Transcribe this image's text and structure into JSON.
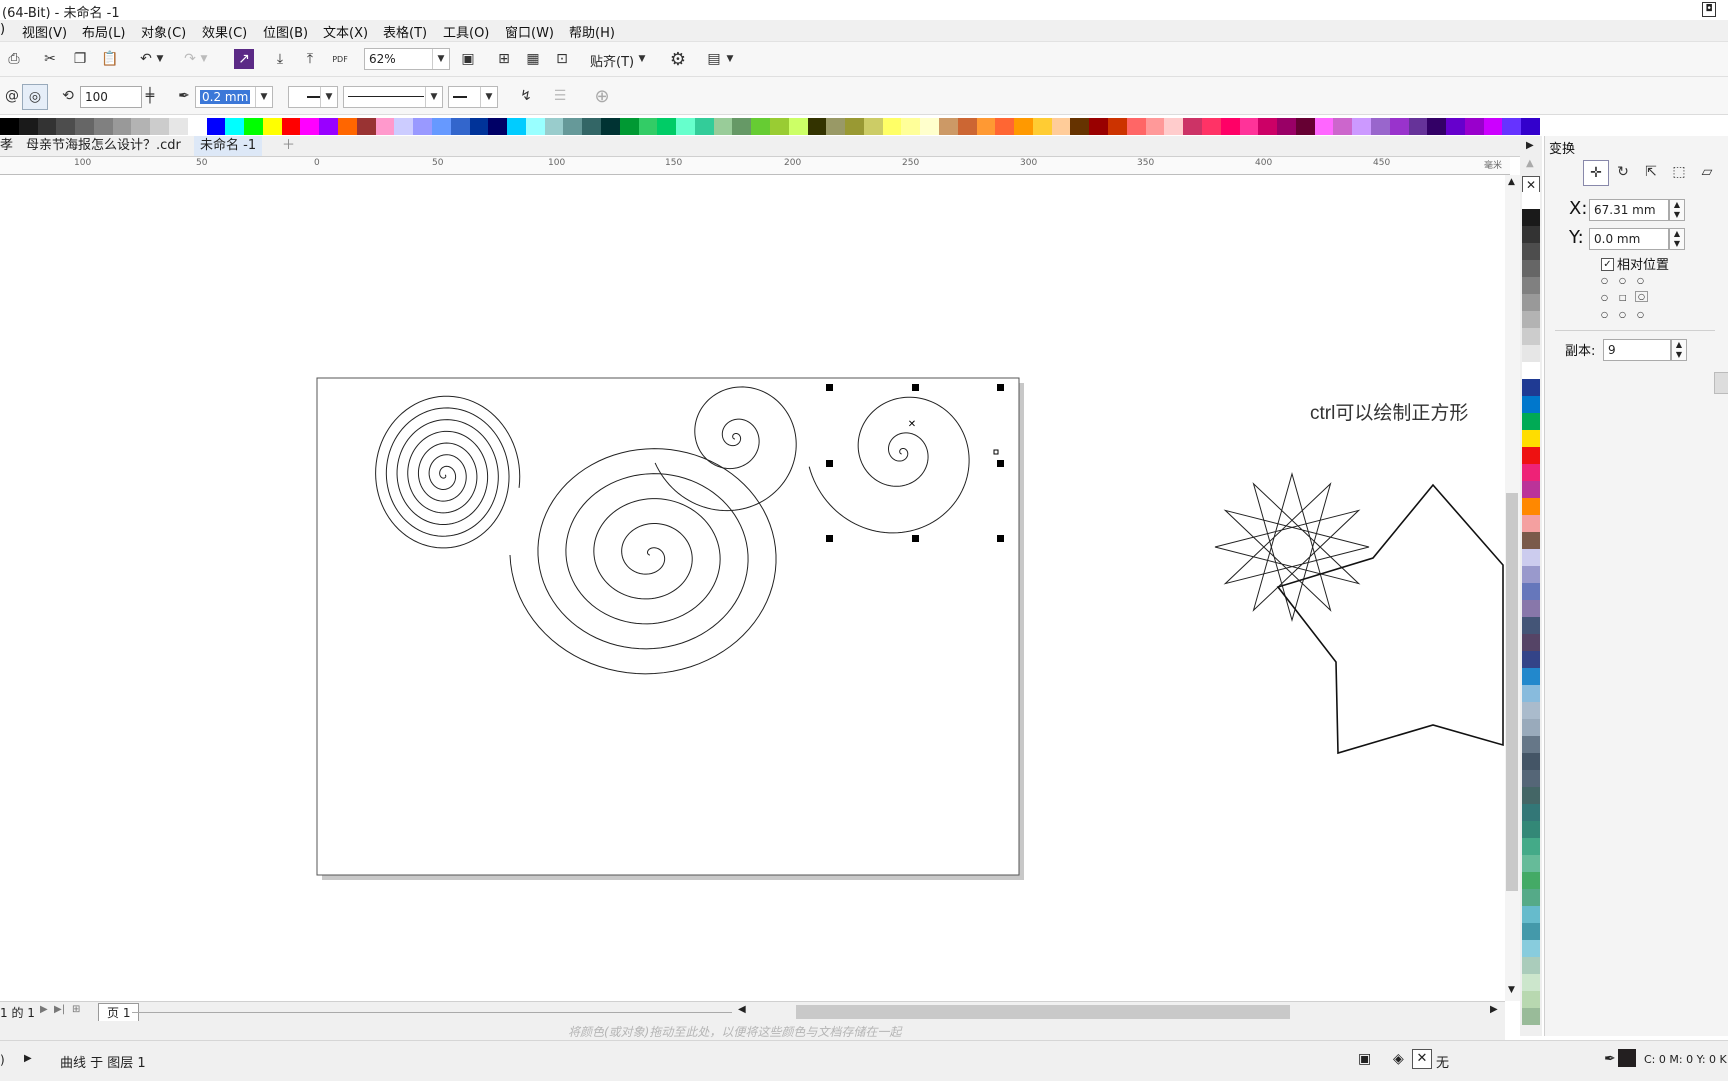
{
  "window": {
    "title": "(64-Bit) - 未命名 -1"
  },
  "menu": [
    "视图(V)",
    "布局(L)",
    "对象(C)",
    "效果(C)",
    "位图(B)",
    "文本(X)",
    "表格(T)",
    "工具(O)",
    "窗口(W)",
    "帮助(H)"
  ],
  "menu_partial": ")",
  "toolbar": {
    "zoom_value": "62%",
    "snap_label": "贴齐(T)",
    "pdf_label": "PDF"
  },
  "property_bar": {
    "revolutions_value": "100",
    "outline_width": "0.2 mm"
  },
  "palette_colors": [
    "#000000",
    "#1a1a1a",
    "#333333",
    "#4d4d4d",
    "#666666",
    "#808080",
    "#999999",
    "#b3b3b3",
    "#cccccc",
    "#e6e6e6",
    "#ffffff",
    "#0000ff",
    "#00ffff",
    "#00ff00",
    "#ffff00",
    "#ff0000",
    "#ff00ff",
    "#9900ff",
    "#ff6600",
    "#993333",
    "#ff99cc",
    "#ccccff",
    "#9999ff",
    "#6699ff",
    "#3366cc",
    "#003399",
    "#000066",
    "#00ccff",
    "#99ffff",
    "#99cccc",
    "#669999",
    "#336666",
    "#003333",
    "#009933",
    "#33cc66",
    "#00cc66",
    "#66ffcc",
    "#33cc99",
    "#99cc99",
    "#669966",
    "#66cc33",
    "#99cc33",
    "#ccff66",
    "#333300",
    "#999966",
    "#999933",
    "#cccc66",
    "#ffff66",
    "#ffff99",
    "#ffffcc",
    "#cc9966",
    "#cc6633",
    "#ff9933",
    "#ff6633",
    "#ff9900",
    "#ffcc33",
    "#ffcc99",
    "#663300",
    "#990000",
    "#cc3300",
    "#ff6666",
    "#ff9999",
    "#ffcccc",
    "#cc3366",
    "#ff3366",
    "#ff0066",
    "#ff3399",
    "#cc0066",
    "#990066",
    "#660033",
    "#ff66ff",
    "#cc66cc",
    "#cc99ff",
    "#9966cc",
    "#9933cc",
    "#663399",
    "#330066",
    "#6600cc",
    "#9900cc",
    "#cc00ff",
    "#6633ff",
    "#3300cc"
  ],
  "vertical_palette_colors": [
    "#ffffff",
    "#1a1a1a",
    "#333333",
    "#4d4d4d",
    "#666666",
    "#808080",
    "#999999",
    "#b3b3b3",
    "#cccccc",
    "#e6e6e6",
    "#ffffff",
    "#1f3a93",
    "#0077cc",
    "#00aa55",
    "#ffdd00",
    "#ee1111",
    "#ee2277",
    "#bb3399",
    "#ff8800",
    "#f4a0a0",
    "#7a5a4a",
    "#ccccee",
    "#9999cc",
    "#6677bb",
    "#8877aa",
    "#445577",
    "#554466",
    "#334488",
    "#2288cc",
    "#88bbdd",
    "#aabbcc",
    "#99aabb",
    "#667788",
    "#445566",
    "#556677",
    "#446666",
    "#337777",
    "#338877",
    "#44aa88",
    "#66bb99",
    "#44aa66",
    "#55aa88",
    "#66bbcc",
    "#4499aa",
    "#88ccdd",
    "#aaccbb",
    "#cce6cc",
    "#b8d8b0",
    "#99bb99"
  ],
  "tabs": [
    {
      "label": "母亲节海报怎么设计？.cdr",
      "active": false
    },
    {
      "label": "未命名 -1",
      "active": true
    }
  ],
  "tab_partial": "孝",
  "ruler_labels": [
    "100",
    "50",
    "0",
    "50",
    "100",
    "150",
    "200",
    "250",
    "300",
    "350",
    "400",
    "450"
  ],
  "ruler_unit": "毫米",
  "canvas": {
    "annotation": "ctrl可以绘制正方形"
  },
  "docker": {
    "title": "变换",
    "x_label": "X:",
    "x_value": "67.31 mm",
    "y_label": "Y:",
    "y_value": "0.0 mm",
    "relative_label": "相对位置",
    "relative_checked": true,
    "copies_label": "副本:",
    "copies_value": "9"
  },
  "pagebar": {
    "page_of": "1 的 1",
    "page_tab": "页 1"
  },
  "hint_text": "将颜色(或对象)拖动至此处，以便将这些颜色与文档存储在一起",
  "status": {
    "left_partial": ")",
    "object_info": "曲线 于 图层 1",
    "fill_none": "无",
    "color_info": "C: 0 M: 0 Y: 0 K:"
  }
}
